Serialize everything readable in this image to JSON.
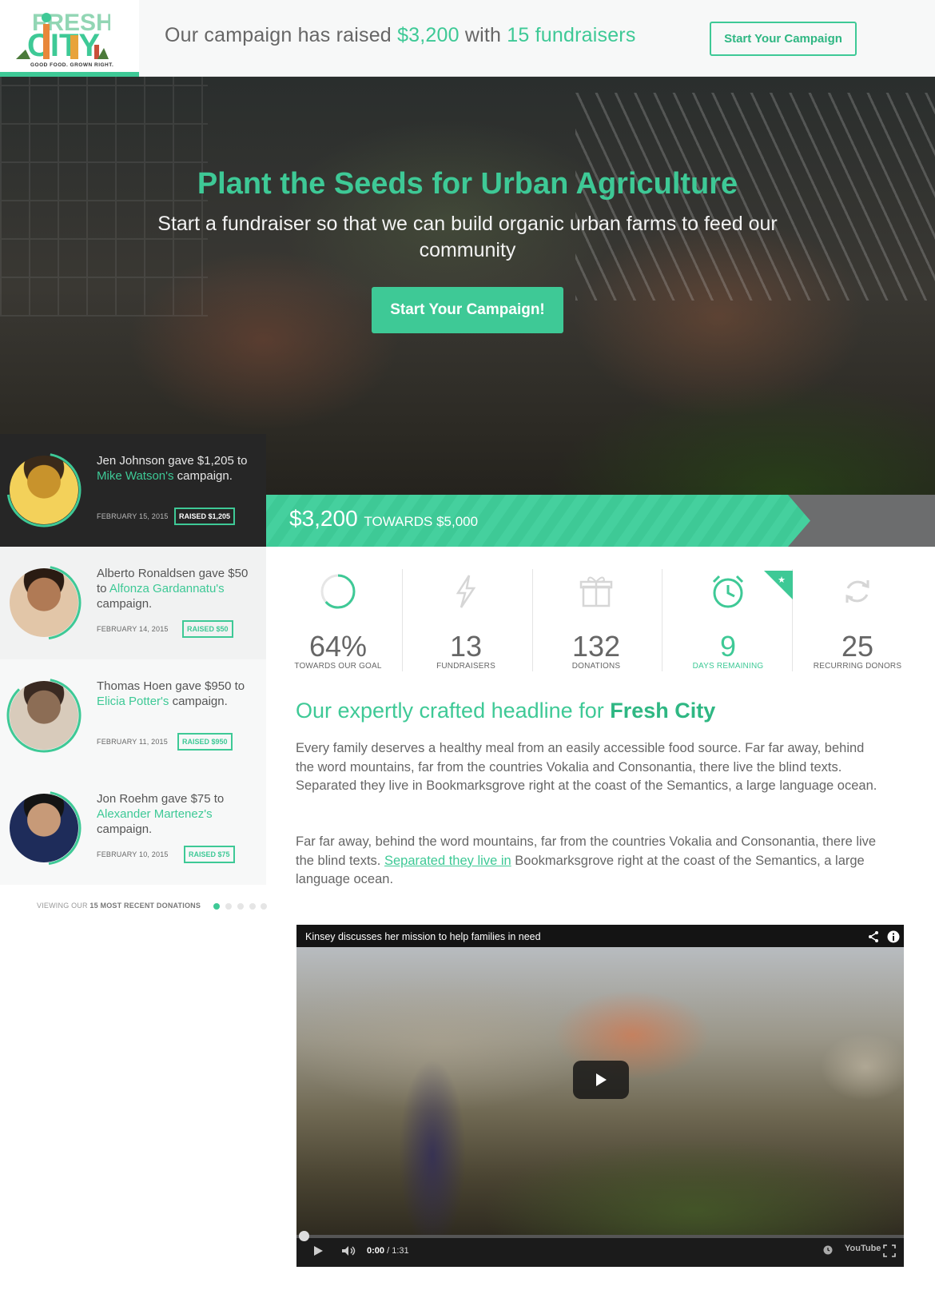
{
  "header": {
    "logo_text": "FRESH CITY",
    "logo_tagline": "GOOD FOOD. GROWN RIGHT.",
    "raised_prefix": "Our campaign has raised ",
    "raised_amount": "$3,200",
    "raised_mid": " with ",
    "fundraisers_count": "15 fundraisers",
    "cta_label": "Start Your Campaign"
  },
  "hero": {
    "title": "Plant the Seeds for Urban Agriculture",
    "subtitle": "Start a fundraiser so that we can build organic urban farms to feed our community",
    "cta_label": "Start Your Campaign!"
  },
  "progress": {
    "amount": "$3,200",
    "towards": "TOWARDS $5,000",
    "fraction": 0.64
  },
  "donations": [
    {
      "pre": "Jen Johnson gave $1,205 to ",
      "link": "Mike Watson's",
      "post": " campaign.",
      "date": "FEBRUARY 15, 2015",
      "raised": "RAISED $1,205",
      "ring": 0.7
    },
    {
      "pre": "Alberto Ronaldsen gave $50 to ",
      "link": "Alfonza Gardannatu's",
      "post": " campaign.",
      "date": "FEBRUARY 14, 2015",
      "raised": "RAISED $50",
      "ring": 0.45
    },
    {
      "pre": "Thomas Hoen gave $950 to ",
      "link": "Elicia Potter's",
      "post": " campaign.",
      "date": "FEBRUARY 11, 2015",
      "raised": "RAISED $950",
      "ring": 0.85
    },
    {
      "pre": "Jon Roehm gave $75 to ",
      "link": "Alexander Martenez's",
      "post": " campaign.",
      "date": "FEBRUARY 10, 2015",
      "raised": "RAISED $75",
      "ring": 0.45
    }
  ],
  "pager": {
    "prefix": "VIEWING OUR ",
    "bold": "15 MOST RECENT DONATIONS"
  },
  "stats": [
    {
      "value": "64%",
      "label": "TOWARDS OUR GOAL",
      "icon": "progress-ring-icon"
    },
    {
      "value": "13",
      "label": "FUNDRAISERS",
      "icon": "lightning-icon"
    },
    {
      "value": "132",
      "label": "DONATIONS",
      "icon": "gift-icon"
    },
    {
      "value": "9",
      "label": "DAYS REMAINING",
      "icon": "alarm-clock-icon"
    },
    {
      "value": "25",
      "label": "RECURRING DONORS",
      "icon": "refresh-icon"
    }
  ],
  "article": {
    "headline_pre": "Our expertly crafted headline for ",
    "headline_bold": "Fresh City",
    "para1": "Every family deserves a healthy meal from an easily accessible food source. Far far away, behind the word mountains, far from the countries Vokalia and Consonantia, there live the blind texts. Separated they live in Bookmarksgrove right at the coast of the Semantics, a large language ocean.",
    "para2_pre": "Far far away, behind the word mountains, far from the countries Vokalia and Consonantia, there live the blind texts. ",
    "para2_link": "Separated they live in",
    "para2_post": " Bookmarksgrove right at the coast of the Semantics, a large language ocean."
  },
  "video": {
    "title": "Kinsey discusses her mission to help families in need",
    "time_current": "0:00",
    "time_total": " / 1:31",
    "brand": "YouTube"
  },
  "colors": {
    "accent": "#3ec996",
    "accent_dark": "#2fb783",
    "dark_panel": "#262626",
    "progress_bg": "#6c6d6e"
  }
}
